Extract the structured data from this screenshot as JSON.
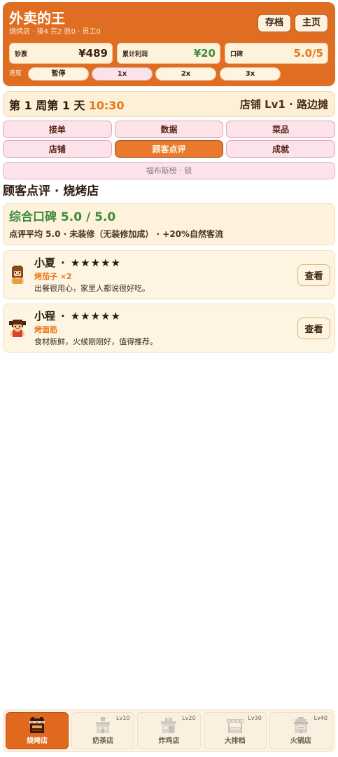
{
  "header": {
    "title": "外卖的王",
    "subtitle": "烧烤店 · 接4 完2 败0 · 员工0",
    "save_label": "存档",
    "home_label": "主页"
  },
  "stats": [
    {
      "label": "钞票",
      "value": "¥489",
      "color": "#3A2512"
    },
    {
      "label": "累计利润",
      "value": "¥20",
      "color": "#3F8B3A"
    },
    {
      "label": "口碑",
      "value": "5.0/5",
      "color": "#E2781E"
    }
  ],
  "speed": {
    "label": "速度",
    "options": [
      {
        "label": "暂停",
        "active": false
      },
      {
        "label": "1x",
        "active": true
      },
      {
        "label": "2x",
        "active": false
      },
      {
        "label": "3x",
        "active": false
      }
    ]
  },
  "status": {
    "date": "第 1 周第 1 天",
    "time": "10:30",
    "shop": "店铺 Lv1 · 路边摊"
  },
  "tabs": [
    {
      "label": "接单",
      "active": false
    },
    {
      "label": "数据",
      "active": false
    },
    {
      "label": "菜品",
      "active": false
    },
    {
      "label": "店铺",
      "active": false
    },
    {
      "label": "顾客点评",
      "active": true
    },
    {
      "label": "成就",
      "active": false
    }
  ],
  "locked_tab": {
    "label": "福布斯榜 · 锁"
  },
  "section_title": "顾客点评 · 烧烤店",
  "summary": {
    "headline": "综合口碑 5.0 / 5.0",
    "detail": "点评平均 5.0 · 未装修（无装修加成） · +20%自然客流"
  },
  "separator": "·",
  "reviews": [
    {
      "name": "小夏",
      "rating": 5,
      "dish": "烤茄子 ×2",
      "comment": "出餐很用心，家里人都说很好吃。",
      "action": "查看",
      "avatar_icon": "girl-brown-hair-avatar-icon"
    },
    {
      "name": "小程",
      "rating": 5,
      "dish": "烤面筋",
      "comment": "食材新鲜，火候刚刚好，值得推荐。",
      "action": "查看",
      "avatar_icon": "girl-pigtails-avatar-icon"
    }
  ],
  "bottom_nav": [
    {
      "label": "烧烤店",
      "icon": "bbq-stall-icon",
      "active": true,
      "locked": false
    },
    {
      "label": "奶茶店",
      "level": "Lv10",
      "icon": "milk-tea-shop-icon",
      "active": false,
      "locked": true
    },
    {
      "label": "炸鸡店",
      "level": "Lv20",
      "icon": "fried-chicken-shop-icon",
      "active": false,
      "locked": true
    },
    {
      "label": "大排档",
      "level": "Lv30",
      "icon": "food-stall-icon",
      "active": false,
      "locked": true
    },
    {
      "label": "火锅店",
      "level": "Lv40",
      "icon": "hotpot-shop-icon",
      "active": false,
      "locked": true
    }
  ],
  "colors": {
    "brand_orange": "#DF6E22",
    "cream": "#FFF2DC",
    "tab_pink": "#FCE3EA",
    "success_green": "#3E8B3E",
    "dish_orange": "#E5781C"
  }
}
